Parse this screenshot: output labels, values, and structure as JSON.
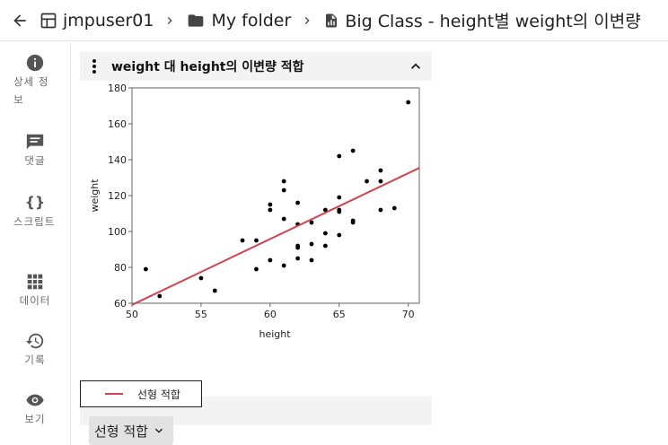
{
  "topbar": {
    "crumbs": [
      "jmpuser01",
      "My folder",
      "Big Class - height별 weight의 이변량"
    ]
  },
  "sidebar": {
    "items": [
      {
        "label": "상세 정보",
        "icon": "info-icon"
      },
      {
        "label": "댓글",
        "icon": "comment-icon"
      },
      {
        "label": "스크립트",
        "icon": "script-braces-icon"
      },
      {
        "label": "데이터",
        "icon": "table-grid-icon"
      },
      {
        "label": "기록",
        "icon": "history-icon"
      },
      {
        "label": "보기",
        "icon": "eye-icon"
      }
    ]
  },
  "panel": {
    "title": "weight 대 height의 이변량 적합",
    "legend_label": "선형 적합",
    "fit_button_label": "선형 적합"
  },
  "colors": {
    "fit_line": "#d0444f",
    "points": "#000000",
    "panel_bg": "#f3f3f3"
  },
  "chart_data": {
    "type": "scatter",
    "xlabel": "height",
    "ylabel": "weight",
    "xlim": [
      50,
      70.8
    ],
    "ylim": [
      60,
      180
    ],
    "xticks": [
      50,
      55,
      60,
      65,
      70
    ],
    "yticks": [
      60,
      80,
      100,
      120,
      140,
      160,
      180
    ],
    "points": [
      [
        51,
        79
      ],
      [
        52,
        64
      ],
      [
        55,
        74
      ],
      [
        56,
        67
      ],
      [
        58,
        95
      ],
      [
        59,
        95
      ],
      [
        59,
        79
      ],
      [
        60,
        115
      ],
      [
        60,
        112
      ],
      [
        60,
        84
      ],
      [
        61,
        128
      ],
      [
        61,
        123
      ],
      [
        61,
        107
      ],
      [
        61,
        81
      ],
      [
        62,
        116
      ],
      [
        62,
        104
      ],
      [
        62,
        92
      ],
      [
        62,
        91
      ],
      [
        62,
        85
      ],
      [
        63,
        105
      ],
      [
        63,
        93
      ],
      [
        63,
        84
      ],
      [
        64,
        112
      ],
      [
        64,
        99
      ],
      [
        64,
        92
      ],
      [
        65,
        142
      ],
      [
        65,
        119
      ],
      [
        65,
        112
      ],
      [
        65,
        111
      ],
      [
        65,
        98
      ],
      [
        66,
        145
      ],
      [
        66,
        106
      ],
      [
        66,
        105
      ],
      [
        67,
        128
      ],
      [
        68,
        134
      ],
      [
        68,
        128
      ],
      [
        68,
        112
      ],
      [
        69,
        113
      ],
      [
        70,
        172
      ]
    ],
    "fit_line": {
      "name": "선형 적합",
      "x": [
        50,
        70.8
      ],
      "y": [
        59.1,
        135.4
      ]
    },
    "grid": false
  }
}
